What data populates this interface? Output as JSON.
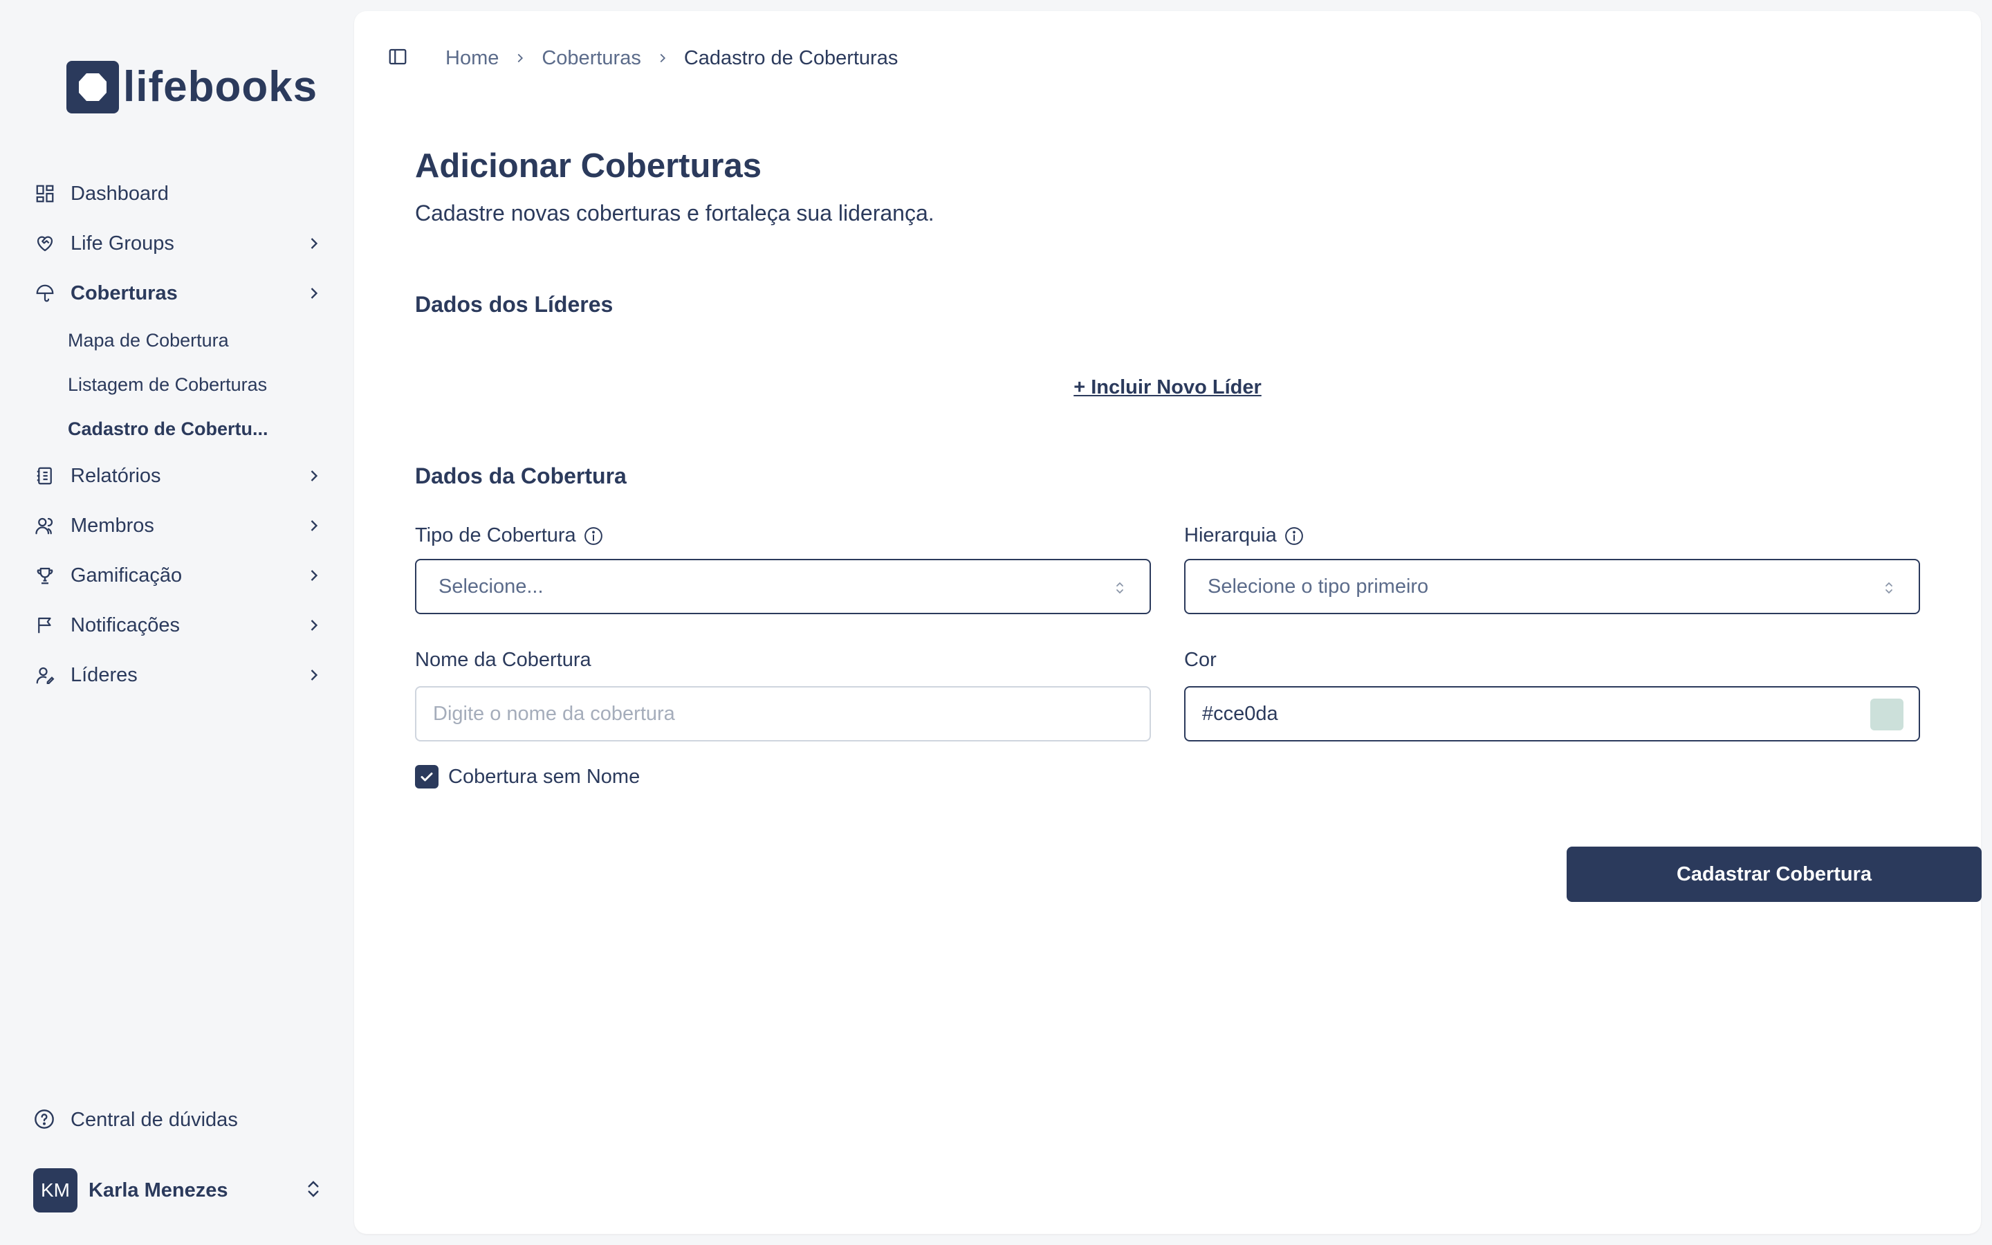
{
  "brand": {
    "name": "lifebooks"
  },
  "sidebar": {
    "items": [
      {
        "label": "Dashboard",
        "icon": "dashboard-icon"
      },
      {
        "label": "Life Groups",
        "icon": "heart-handshake-icon"
      },
      {
        "label": "Coberturas",
        "icon": "umbrella-icon",
        "active": true,
        "children": [
          {
            "label": "Mapa de Cobertura"
          },
          {
            "label": "Listagem de Coberturas"
          },
          {
            "label": "Cadastro de Cobertu...",
            "active": true
          }
        ]
      },
      {
        "label": "Relatórios",
        "icon": "notebook-icon"
      },
      {
        "label": "Membros",
        "icon": "users-icon"
      },
      {
        "label": "Gamificação",
        "icon": "trophy-icon"
      },
      {
        "label": "Notificações",
        "icon": "flag-message-icon"
      },
      {
        "label": "Líderes",
        "icon": "user-pen-icon"
      }
    ],
    "help": {
      "label": "Central de dúvidas",
      "icon": "help-circle-icon"
    },
    "user": {
      "initials": "KM",
      "name": "Karla Menezes"
    }
  },
  "breadcrumb": [
    "Home",
    "Coberturas",
    "Cadastro de Coberturas"
  ],
  "page": {
    "title": "Adicionar Coberturas",
    "subtitle": "Cadastre novas coberturas e fortaleça sua liderança."
  },
  "leaders_section": {
    "title": "Dados dos Líderes",
    "add_link": "+ Incluir Novo Líder"
  },
  "coverage_section": {
    "title": "Dados da Cobertura",
    "type": {
      "label": "Tipo de Cobertura",
      "value": "Selecione..."
    },
    "hierarchy": {
      "label": "Hierarquia",
      "value": "Selecione o tipo primeiro"
    },
    "name": {
      "label": "Nome da Cobertura",
      "placeholder": "Digite o nome da cobertura"
    },
    "color": {
      "label": "Cor",
      "value": "#cce0da",
      "swatch": "#cce0da"
    },
    "unnamed_checkbox": {
      "label": "Cobertura sem Nome",
      "checked": true
    }
  },
  "submit_label": "Cadastrar Cobertura",
  "colors": {
    "primary": "#2b3a5c",
    "background": "#f5f6f8",
    "muted_text": "#5b6b8a"
  }
}
